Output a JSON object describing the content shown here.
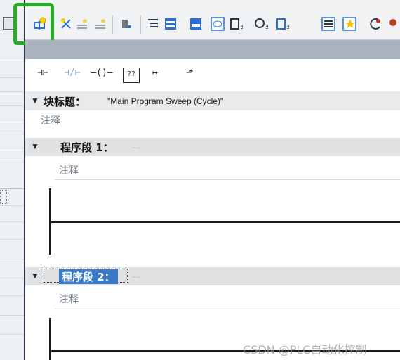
{
  "toolbar": {
    "icons": [
      {
        "name": "insert-network-icon",
        "color": "#2a6fd0"
      },
      {
        "name": "delete-network-icon",
        "color": "#2a6fd0"
      },
      {
        "name": "insert-row-icon",
        "color": "#9aa5b1"
      },
      {
        "name": "delete-row-icon",
        "color": "#9aa5b1"
      },
      {
        "name": "clear-icon",
        "color": "#6d7884"
      },
      {
        "name": "open-all-networks-icon",
        "color": "#2a6fd0"
      },
      {
        "name": "close-all-networks-icon",
        "color": "#2a6fd0"
      },
      {
        "name": "network-comments-icon",
        "color": "#2a6fd0"
      },
      {
        "name": "absolute-operand-icon",
        "color": "#2a6fd0"
      },
      {
        "name": "symbolic-operand-icon",
        "color": "#2a6fd0"
      },
      {
        "name": "display-favorites-icon",
        "color": "#2a6fd0"
      },
      {
        "name": "favorites-icon",
        "color": "#e8a400"
      },
      {
        "name": "jump-back-icon",
        "color": "#c0392b"
      }
    ]
  },
  "instructions": {
    "no_contact": "⊣⊢",
    "nc_contact": "⊣/⊢",
    "coil": "–()–",
    "empty_box": "??",
    "open_branch": "↦",
    "close_branch": "⬏"
  },
  "block": {
    "title_label": "块标题：",
    "title_value": "\"Main Program Sweep (Cycle)\"",
    "comment": "注释"
  },
  "networks": [
    {
      "label": "程序段 1：",
      "dots": ".....",
      "comment": "注释",
      "selected": false
    },
    {
      "label": "程序段 2：",
      "dots": ".....",
      "comment": "注释",
      "selected": true
    }
  ],
  "watermark": "CSDN @PLC自动化控制"
}
